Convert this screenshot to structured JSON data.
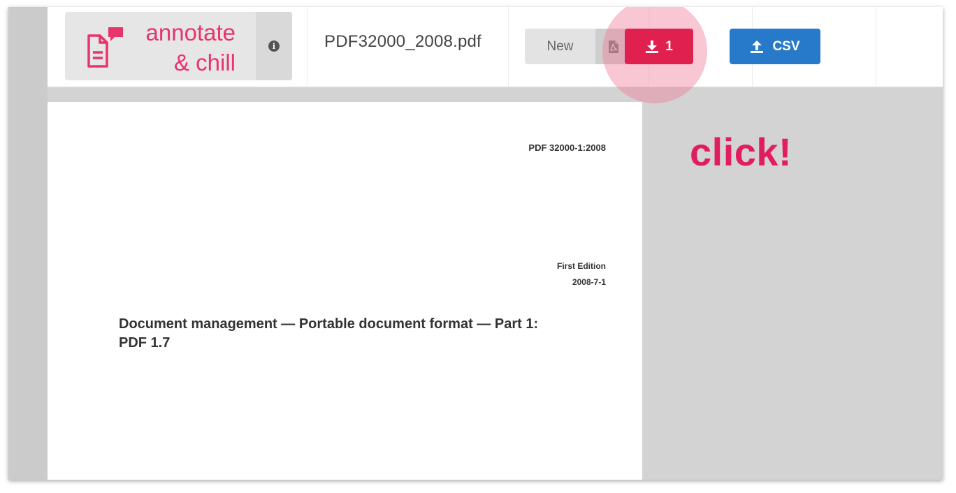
{
  "app": {
    "brand_line1": "annotate",
    "brand_line2": "& chill",
    "brand_color": "#e8336b",
    "logo_icon": "document-comment-icon",
    "info_icon": "info-icon"
  },
  "toolbar": {
    "filename": "PDF32000_2008.pdf",
    "new_label": "New",
    "pdf_icon": "pdf-file-icon",
    "download_label": "1",
    "download_icon": "download-icon",
    "download_color": "#e0204e",
    "csv_label": "CSV",
    "csv_icon": "upload-icon",
    "csv_color": "#2779c9"
  },
  "callout": {
    "text": "click!",
    "color": "#e21d5e"
  },
  "document": {
    "doc_id": "PDF 32000-1:2008",
    "edition": "First Edition",
    "date": "2008-7-1",
    "title_line1": "Document management — Portable document format — Part 1:",
    "title_line2": "PDF 1.7"
  }
}
